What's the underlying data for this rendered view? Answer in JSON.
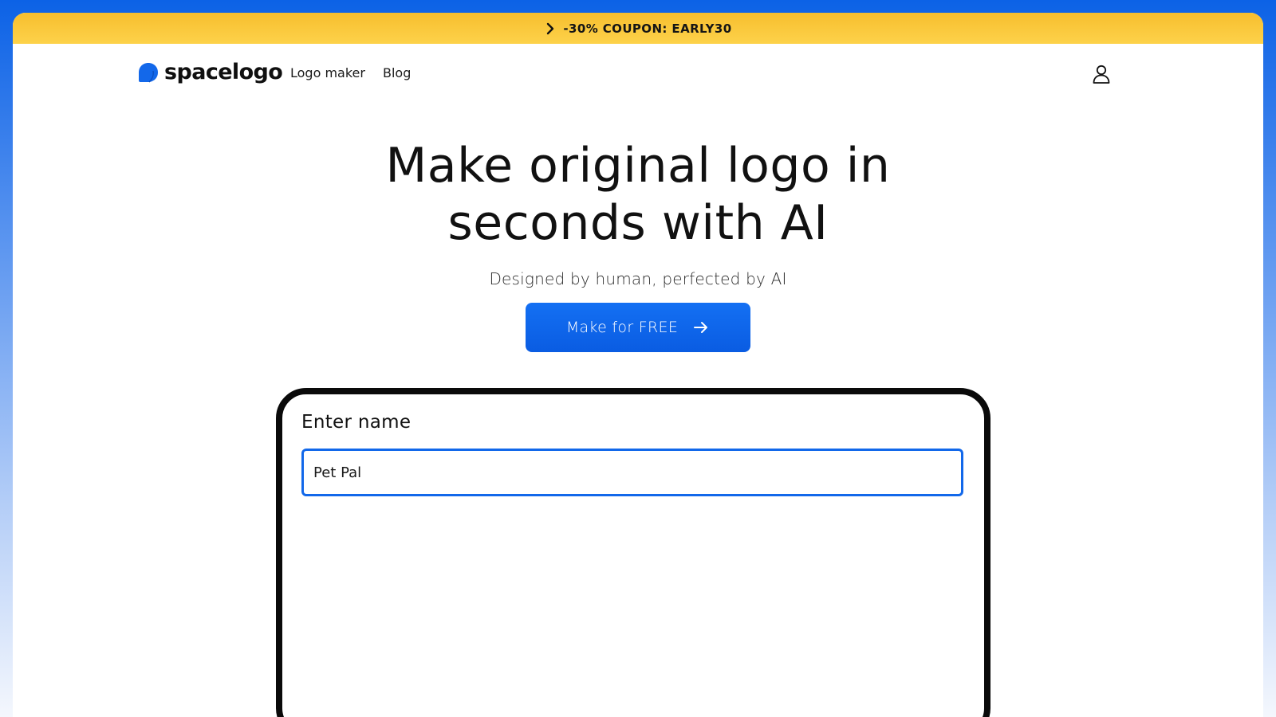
{
  "promo": {
    "text": "-30% COUPON: EARLY30",
    "icon": "chevron-right-icon"
  },
  "nav": {
    "brand": "spacelogo",
    "links": [
      {
        "label": "Logo maker"
      },
      {
        "label": "Blog"
      }
    ],
    "account_icon": "user-icon"
  },
  "hero": {
    "title": "Make original logo in seconds with AI",
    "subtitle": "Designed by human, perfected by AI",
    "cta_label": "Make for FREE",
    "cta_icon": "arrow-right-icon"
  },
  "form": {
    "label": "Enter name",
    "name_value": "Pet Pal"
  },
  "colors": {
    "accent_blue": "#0c62e6",
    "promo_yellow": "#fdd24a",
    "text_dark": "#111111"
  }
}
